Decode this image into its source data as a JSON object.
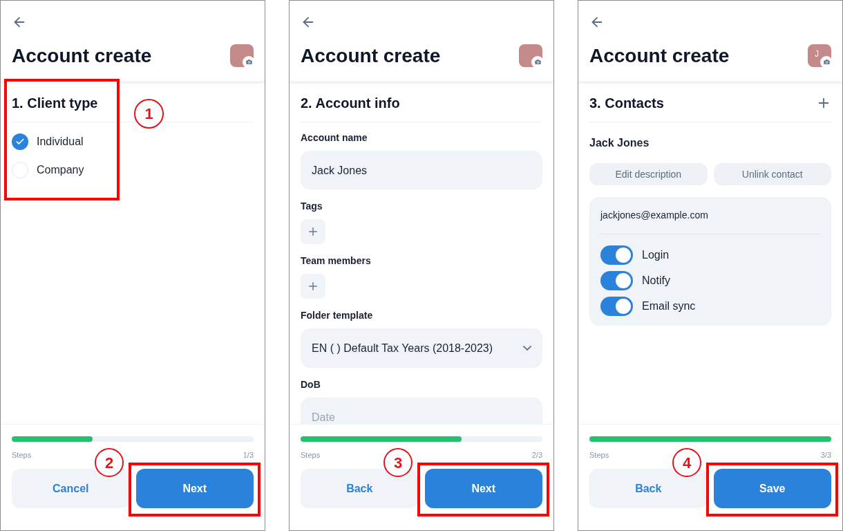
{
  "screens": [
    {
      "kind": "client_type",
      "title": "Account create",
      "section_title": "1. Client type",
      "section_callout": "1",
      "options": [
        {
          "label": "Individual",
          "selected": true
        },
        {
          "label": "Company",
          "selected": false
        }
      ],
      "progress": {
        "label": "Steps",
        "count": "1/3",
        "level": 0.333
      },
      "buttons": [
        {
          "label": "Cancel",
          "kind": "secondary"
        },
        {
          "label": "Next",
          "kind": "primary",
          "callout": "2"
        }
      ]
    },
    {
      "kind": "account_info",
      "title": "Account create",
      "section_title": "2. Account info",
      "fields": [
        {
          "kind": "text",
          "label": "Account name",
          "value": "Jack Jones"
        },
        {
          "kind": "add",
          "label": "Tags"
        },
        {
          "kind": "add",
          "label": "Team members"
        },
        {
          "kind": "select",
          "label": "Folder template",
          "value": "EN ( ) Default Tax Years (2018-2023)"
        },
        {
          "kind": "text",
          "label": "DoB",
          "placeholder": "Date"
        }
      ],
      "progress": {
        "label": "Steps",
        "count": "2/3",
        "level": 0.667
      },
      "buttons": [
        {
          "label": "Back",
          "kind": "secondary"
        },
        {
          "label": "Next",
          "kind": "primary",
          "callout": "3"
        }
      ]
    },
    {
      "kind": "contacts",
      "title": "Account create",
      "avatar_initials": "J",
      "section_title": "3. Contacts",
      "contact": {
        "name": "Jack Jones",
        "actions": [
          "Edit description",
          "Unlink contact"
        ],
        "email": "jackjones@example.com",
        "toggles": [
          {
            "label": "Login",
            "on": true
          },
          {
            "label": "Notify",
            "on": true
          },
          {
            "label": "Email sync",
            "on": true
          }
        ]
      },
      "progress": {
        "label": "Steps",
        "count": "3/3",
        "level": 1
      },
      "buttons": [
        {
          "label": "Back",
          "kind": "secondary"
        },
        {
          "label": "Save",
          "kind": "primary",
          "callout": "4"
        }
      ]
    }
  ]
}
